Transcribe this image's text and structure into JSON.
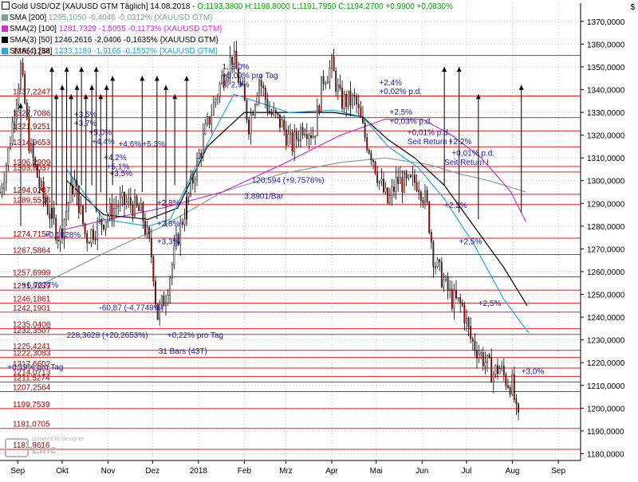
{
  "header": {
    "line1_prefix": "Gold USD/OZ [XAUUSD GTM  Täglich] 14.08.2018 - ",
    "line1_ohlc": "O:1193,3800 H:1198,8000 L:1191,7950 C:1194,2700 +0,9900 +0,0830%",
    "line2": "SMA [200]",
    "line2_values": "1295,1050 -0,4046 -0,0312% {XAUUSD GTM}",
    "line3": "SMA(2) [100]",
    "line3_values": "1281,7329 -1,5055 -0,1173% {XAUUSD GTM}",
    "line4": "SMA(3) [50]",
    "line4_values": "1246,2616 -2,0406 -0,1635% {XAUUSD GTM}",
    "line5": "SMA(4) [38]",
    "line5_values": "1233,1189 -1,9166 -0,1552% {XAUUSD GTM}",
    "currency": "$"
  },
  "colors": {
    "candle_up": "#ffffff",
    "candle_down": "#cc0000",
    "sma200": "#7aa39a",
    "sma100": "#cc33cc",
    "sma50": "#000000",
    "sma38": "#22aadd",
    "hline": "#dd2222",
    "annot": "#1a1aaa",
    "grid": "#c8c8c8"
  },
  "chart_data": {
    "type": "candlestick",
    "title": "Gold USD/OZ [XAUUSD GTM Täglich]",
    "ylim": [
      1177,
      1378
    ],
    "y_ticks": [
      1180,
      1190,
      1200,
      1210,
      1220,
      1230,
      1240,
      1250,
      1260,
      1270,
      1280,
      1290,
      1300,
      1310,
      1320,
      1330,
      1340,
      1350,
      1360,
      1370
    ],
    "y_tick_labels": [
      "1180,0000",
      "1190,0000",
      "1200,0000",
      "1210,0000",
      "1220,0000",
      "1230,0000",
      "1240,0000",
      "1250,0000",
      "1260,0000",
      "1270,0000",
      "1280,0000",
      "1290,0000",
      "1300,0000",
      "1310,0000",
      "1320,0000",
      "1330,0000",
      "1340,0000",
      "1350,0000",
      "1360,0000",
      "1370,0000"
    ],
    "x_labels": [
      "Sep",
      "Okt",
      "Nov",
      "Dez",
      "2018",
      "Feb",
      "Mrz",
      "Apr",
      "Mai",
      "Jun",
      "Jul",
      "Aug",
      "Sep"
    ],
    "x_label_days": [
      12,
      42,
      73,
      103,
      134,
      165,
      193,
      224,
      254,
      285,
      315,
      346,
      377
    ],
    "days_span": [
      0,
      392
    ],
    "price_path": [
      [
        0,
        1295
      ],
      [
        5,
        1310
      ],
      [
        14,
        1350
      ],
      [
        20,
        1315
      ],
      [
        28,
        1295
      ],
      [
        40,
        1275
      ],
      [
        50,
        1300
      ],
      [
        58,
        1275
      ],
      [
        66,
        1280
      ],
      [
        73,
        1285
      ],
      [
        80,
        1290
      ],
      [
        88,
        1290
      ],
      [
        96,
        1285
      ],
      [
        103,
        1265
      ],
      [
        106,
        1240
      ],
      [
        112,
        1250
      ],
      [
        120,
        1275
      ],
      [
        130,
        1300
      ],
      [
        138,
        1320
      ],
      [
        145,
        1335
      ],
      [
        150,
        1345
      ],
      [
        157,
        1355
      ],
      [
        163,
        1340
      ],
      [
        168,
        1325
      ],
      [
        175,
        1345
      ],
      [
        182,
        1330
      ],
      [
        190,
        1325
      ],
      [
        197,
        1315
      ],
      [
        205,
        1325
      ],
      [
        212,
        1320
      ],
      [
        218,
        1345
      ],
      [
        224,
        1350
      ],
      [
        230,
        1335
      ],
      [
        240,
        1335
      ],
      [
        246,
        1320
      ],
      [
        252,
        1310
      ],
      [
        256,
        1300
      ],
      [
        262,
        1290
      ],
      [
        268,
        1300
      ],
      [
        275,
        1298
      ],
      [
        282,
        1300
      ],
      [
        288,
        1290
      ],
      [
        293,
        1265
      ],
      [
        300,
        1255
      ],
      [
        305,
        1248
      ],
      [
        312,
        1245
      ],
      [
        318,
        1230
      ],
      [
        323,
        1225
      ],
      [
        328,
        1220
      ],
      [
        333,
        1215
      ],
      [
        337,
        1218
      ],
      [
        342,
        1212
      ],
      [
        346,
        1210
      ],
      [
        349,
        1195
      ],
      [
        350,
        1194
      ]
    ],
    "sma_series": [
      {
        "name": "SMA [200]",
        "points": [
          [
            30,
            1255
          ],
          [
            70,
            1268
          ],
          [
            110,
            1280
          ],
          [
            150,
            1295
          ],
          [
            190,
            1303
          ],
          [
            230,
            1308
          ],
          [
            260,
            1310
          ],
          [
            290,
            1307
          ],
          [
            310,
            1303
          ],
          [
            330,
            1300
          ],
          [
            355,
            1295
          ]
        ]
      },
      {
        "name": "SMA(2) [100]",
        "points": [
          [
            40,
            1278
          ],
          [
            80,
            1284
          ],
          [
            110,
            1288
          ],
          [
            150,
            1295
          ],
          [
            190,
            1307
          ],
          [
            230,
            1320
          ],
          [
            260,
            1327
          ],
          [
            285,
            1327
          ],
          [
            305,
            1320
          ],
          [
            325,
            1310
          ],
          [
            345,
            1295
          ],
          [
            355,
            1282
          ]
        ]
      },
      {
        "name": "SMA(3) [50]",
        "points": [
          [
            45,
            1300
          ],
          [
            70,
            1285
          ],
          [
            100,
            1283
          ],
          [
            120,
            1288
          ],
          [
            140,
            1315
          ],
          [
            165,
            1330
          ],
          [
            195,
            1330
          ],
          [
            225,
            1330
          ],
          [
            245,
            1328
          ],
          [
            262,
            1318
          ],
          [
            280,
            1310
          ],
          [
            300,
            1298
          ],
          [
            320,
            1280
          ],
          [
            340,
            1262
          ],
          [
            356,
            1245
          ]
        ]
      },
      {
        "name": "SMA(4) [38]",
        "points": [
          [
            45,
            1305
          ],
          [
            70,
            1283
          ],
          [
            100,
            1280
          ],
          [
            115,
            1283
          ],
          [
            135,
            1310
          ],
          [
            158,
            1338
          ],
          [
            195,
            1330
          ],
          [
            225,
            1331
          ],
          [
            245,
            1328
          ],
          [
            262,
            1315
          ],
          [
            282,
            1306
          ],
          [
            300,
            1292
          ],
          [
            320,
            1272
          ],
          [
            340,
            1248
          ],
          [
            357,
            1233
          ]
        ]
      }
    ],
    "hlines": [
      {
        "value": 1355,
        "label": "1355,1264"
      },
      {
        "value": 1337.2,
        "label": "1337,2247"
      },
      {
        "value": 1327.7,
        "label": "1327,7086"
      },
      {
        "value": 1321.9,
        "label": "1321,9251"
      },
      {
        "value": 1314.9,
        "label": "1314,9653"
      },
      {
        "value": 1306.2,
        "label": "1306,2909"
      },
      {
        "value": 1303.8,
        "label": "1303,8037"
      },
      {
        "value": 1294.0,
        "label": "1294,0207"
      },
      {
        "value": 1289.5,
        "label": "1289,5518"
      },
      {
        "value": 1274.7,
        "label": "1274,7157"
      },
      {
        "value": 1267.5,
        "label": "1267,5864"
      },
      {
        "value": 1257.7,
        "label": "1257,6999"
      },
      {
        "value": 1251.9,
        "label": "1251,9239"
      },
      {
        "value": 1246.2,
        "label": "1246,1861"
      },
      {
        "value": 1242.2,
        "label": "1242,1901"
      },
      {
        "value": 1235.0,
        "label": "1235,0406"
      },
      {
        "value": 1232.4,
        "label": "1232,3507"
      },
      {
        "value": 1225.4,
        "label": "1225,4241"
      },
      {
        "value": 1222.3,
        "label": "1222,3083"
      },
      {
        "value": 1217.6,
        "label": "1217,6602"
      },
      {
        "value": 1214.0,
        "label": "1214,0713"
      },
      {
        "value": 1211.5,
        "label": "1211,5274"
      },
      {
        "value": 1207.3,
        "label": "1207,2564"
      },
      {
        "value": 1199.8,
        "label": "1199,7539"
      },
      {
        "value": 1191.1,
        "label": "1191,0705"
      },
      {
        "value": 1181.9,
        "label": "1181,8616"
      }
    ],
    "annotations": [
      {
        "day": 150,
        "value": 1349,
        "text": "1, 3,0%"
      },
      {
        "day": 150,
        "value": 1345,
        "text": "+0,09% pro Tag"
      },
      {
        "day": 150,
        "value": 1341,
        "text": "2, 2,9%"
      },
      {
        "day": 256,
        "value": 1342,
        "text": "+2,4%"
      },
      {
        "day": 256,
        "value": 1338,
        "text": "+0,02% p.d."
      },
      {
        "day": 263,
        "value": 1329,
        "text": "+2,5%"
      },
      {
        "day": 263,
        "value": 1325,
        "text": "+0,03% p.d."
      },
      {
        "day": 275,
        "value": 1320,
        "text": "+0,01% p.d."
      },
      {
        "day": 275,
        "value": 1316,
        "text": "Seit Return !"
      },
      {
        "day": 303,
        "value": 1316,
        "text": "+2,2%"
      },
      {
        "day": 305,
        "value": 1311,
        "text": "+0,01% p.d."
      },
      {
        "day": 300,
        "value": 1307,
        "text": "Seit Return !"
      },
      {
        "day": 50,
        "value": 1328,
        "text": "+3,5%"
      },
      {
        "day": 50,
        "value": 1324,
        "text": "+3,7%"
      },
      {
        "day": 60,
        "value": 1320,
        "text": "+5,0%"
      },
      {
        "day": 62,
        "value": 1316,
        "text": "+4,4%"
      },
      {
        "day": 80,
        "value": 1315,
        "text": "+4,6%"
      },
      {
        "day": 96,
        "value": 1315,
        "text": "+5,3%"
      },
      {
        "day": 70,
        "value": 1309,
        "text": "+4,2%"
      },
      {
        "day": 72,
        "value": 1305,
        "text": "+5,1%"
      },
      {
        "day": 74,
        "value": 1302,
        "text": "+3,5%"
      },
      {
        "day": 106,
        "value": 1289,
        "text": "+2,8%"
      },
      {
        "day": 106,
        "value": 1280,
        "text": "+2,8%"
      },
      {
        "day": 106,
        "value": 1272,
        "text": "+3,3%"
      },
      {
        "day": 300,
        "value": 1288,
        "text": "+2,2%"
      },
      {
        "day": 310,
        "value": 1272,
        "text": "+2,5%"
      },
      {
        "day": 323,
        "value": 1245,
        "text": "+2,5%"
      },
      {
        "day": 352,
        "value": 1215,
        "text": "+3,0%"
      },
      {
        "day": 113,
        "value": 1231,
        "text": "+0,22% pro Tag"
      },
      {
        "day": 170,
        "value": 1299,
        "text": "120,594 (+9,7576%)"
      },
      {
        "day": 165,
        "value": 1292,
        "text": "3,8901/Bar"
      },
      {
        "day": 67,
        "value": 1243,
        "text": "-60,87 (-4,7749%)"
      },
      {
        "day": 45,
        "value": 1231,
        "text": "228,3628 (+20,2653%)"
      },
      {
        "day": 107,
        "value": 1224,
        "text": "31 Bars (43T)"
      },
      {
        "day": 30,
        "value": 1275,
        "text": "+0,1828%"
      },
      {
        "day": 15,
        "value": 1253,
        "text": "+6,7077%"
      },
      {
        "day": 5,
        "value": 1217,
        "text": "+0,19% pro Tag"
      }
    ]
  },
  "logo": {
    "text": "Line",
    "subtext": "powered by designer"
  }
}
